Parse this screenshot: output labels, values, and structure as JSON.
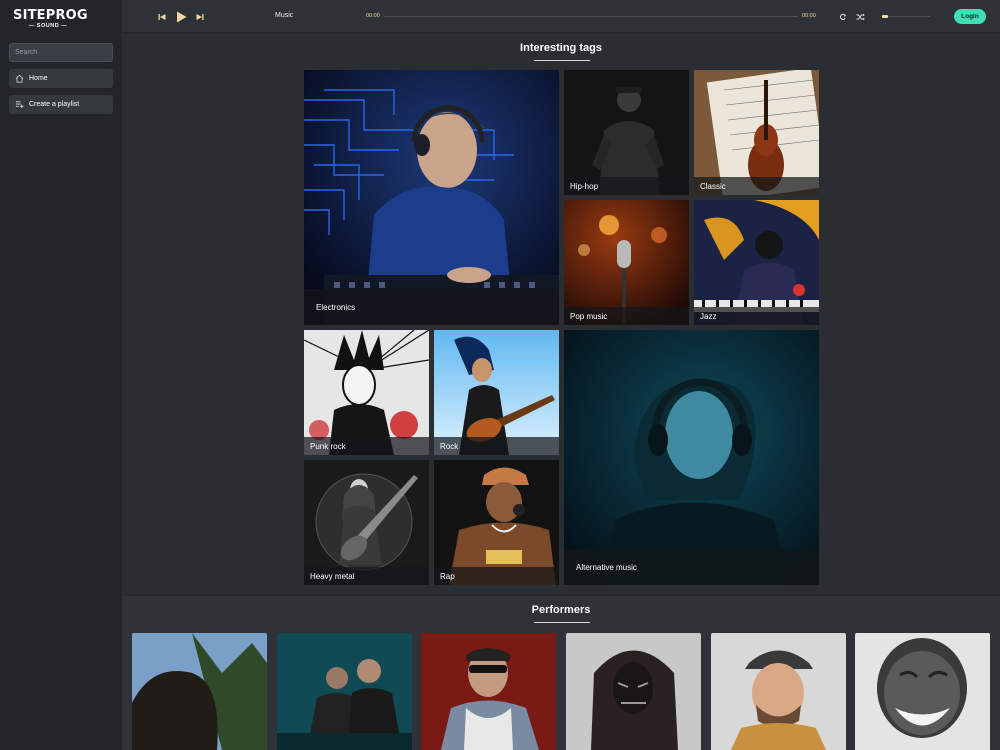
{
  "sidebar": {
    "logo_main": "SITEPROG",
    "logo_sub": "— SOUND —",
    "search_placeholder": "Search",
    "items": [
      {
        "label": "Home",
        "icon": "home-icon"
      },
      {
        "label": "Create a playlist",
        "icon": "playlist-add-icon"
      }
    ]
  },
  "player": {
    "track_title": "Music",
    "current_time": "00:00",
    "total_time": "00:00",
    "progress": 0,
    "volume": 0.12,
    "login_label": "Login",
    "icons": [
      "skip-previous-icon",
      "play-icon",
      "skip-next-icon",
      "repeat-icon",
      "shuffle-icon"
    ]
  },
  "tags": {
    "title": "Interesting tags",
    "items": [
      {
        "label": "Electronics"
      },
      {
        "label": "Hip-hop"
      },
      {
        "label": "Classic"
      },
      {
        "label": "Pop music"
      },
      {
        "label": "Jazz"
      },
      {
        "label": "Punk rock"
      },
      {
        "label": "Rock"
      },
      {
        "label": "Heavy metal"
      },
      {
        "label": "Rap"
      },
      {
        "label": "Alternative music"
      }
    ]
  },
  "performers": {
    "title": "Performers"
  },
  "colors": {
    "accent": "#3fe0b8",
    "player_gold": "#f0d9a0",
    "background": "#272b30",
    "sidebar": "#22262a"
  }
}
